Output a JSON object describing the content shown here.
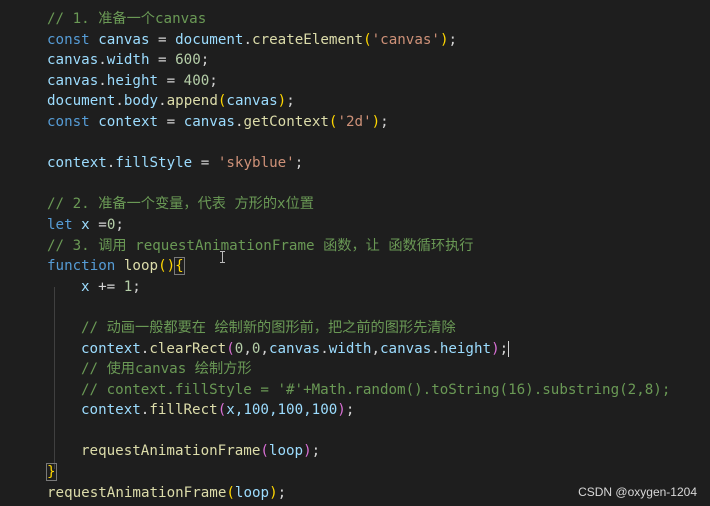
{
  "code": {
    "l1_comment": "// 1. 准备一个canvas",
    "l2": {
      "kw": "const",
      "var": "canvas",
      "op": " = ",
      "obj": "document",
      "dot": ".",
      "fn": "createElement",
      "open": "(",
      "str": "'canvas'",
      "close": ")",
      "end": ";"
    },
    "l3": {
      "var": "canvas",
      "dot": ".",
      "prop": "width",
      "op": " = ",
      "num": "600",
      "end": ";"
    },
    "l4": {
      "var": "canvas",
      "dot": ".",
      "prop": "height",
      "op": " = ",
      "num": "400",
      "end": ";"
    },
    "l5": {
      "obj": "document",
      "dot1": ".",
      "prop": "body",
      "dot2": ".",
      "fn": "append",
      "open": "(",
      "arg": "canvas",
      "close": ")",
      "end": ";"
    },
    "l6": {
      "kw": "const",
      "var": "context",
      "op": " = ",
      "obj": "canvas",
      "dot": ".",
      "fn": "getContext",
      "open": "(",
      "str": "'2d'",
      "close": ")",
      "end": ";"
    },
    "l8": {
      "var": "context",
      "dot": ".",
      "prop": "fillStyle",
      "op": " = ",
      "str": "'skyblue'",
      "end": ";"
    },
    "l10_comment": "// 2. 准备一个变量，代表 方形的x位置",
    "l11": {
      "kw": "let",
      "var": "x",
      "op": " =",
      "num": "0",
      "end": ";"
    },
    "l12_comment": "// 3. 调用 requestAnimationFrame 函数，让 函数循环执行",
    "l13": {
      "kw": "function",
      "fn": "loop",
      "paren": "()",
      "brace": "{"
    },
    "l14": {
      "var": "x",
      "op": " += ",
      "num": "1",
      "end": ";"
    },
    "l16_comment": "// 动画一般都要在 绘制新的图形前，把之前的图形先清除",
    "l17": {
      "obj": "context",
      "dot": ".",
      "fn": "clearRect",
      "open": "(",
      "n1": "0",
      "c1": ",",
      "n2": "0",
      "c2": ",",
      "a1": "canvas",
      "d1": ".",
      "p1": "width",
      "c3": ",",
      "a2": "canvas",
      "d2": ".",
      "p2": "height",
      "close": ")",
      "end": ";"
    },
    "l18_comment": "// 使用canvas 绘制方形",
    "l19_comment": "// context.fillStyle = '#'+Math.random().toString(16).substring(2,8);",
    "l20": {
      "obj": "context",
      "dot": ".",
      "fn": "fillRect",
      "open": "(",
      "args": "x,100,100,100",
      "close": ")",
      "end": ";"
    },
    "l22": {
      "fn": "requestAnimationFrame",
      "open": "(",
      "arg": "loop",
      "close": ")",
      "end": ";"
    },
    "l23": {
      "brace": "}"
    },
    "l24": {
      "fn": "requestAnimationFrame",
      "open": "(",
      "arg": "loop",
      "close": ")",
      "end": ";"
    }
  },
  "watermark": "CSDN @oxygen-1204",
  "colors": {
    "background": "#1e1e1e",
    "comment": "#6a9955",
    "keyword": "#569cd6",
    "variable": "#9cdcfe",
    "function": "#dcdcaa",
    "string": "#ce9178",
    "number": "#b5cea8",
    "bracket_level1": "#ffd700",
    "bracket_level2": "#da70d6"
  }
}
